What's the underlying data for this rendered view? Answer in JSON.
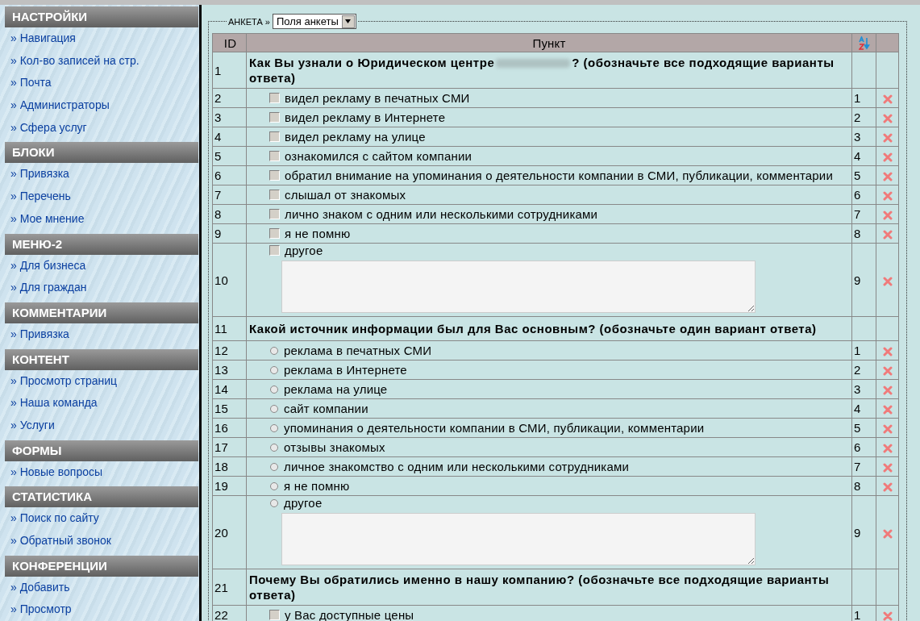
{
  "sidebar": [
    {
      "title": "НАСТРОЙКИ",
      "items": [
        "Навигация",
        "Кол-во записей на стр.",
        "Почта",
        "Администраторы",
        "Сфера услуг"
      ]
    },
    {
      "title": "БЛОКИ",
      "items": [
        "Привязка",
        "Перечень",
        "Мое мнение"
      ]
    },
    {
      "title": "МЕНЮ-2",
      "items": [
        "Для бизнеса",
        "Для граждан"
      ]
    },
    {
      "title": "КОММЕНТАРИИ",
      "items": [
        "Привязка"
      ]
    },
    {
      "title": "КОНТЕНТ",
      "items": [
        "Просмотр страниц",
        "Наша команда",
        "Услуги"
      ]
    },
    {
      "title": "ФОРМЫ",
      "items": [
        "Новые вопросы"
      ]
    },
    {
      "title": "СТАТИСТИКА",
      "items": [
        "Поиск по сайту",
        "Обратный звонок"
      ]
    },
    {
      "title": "КОНФЕРЕНЦИИ",
      "items": [
        "Добавить",
        "Просмотр"
      ]
    }
  ],
  "bullet": "»",
  "breadcrumb": "АНКЕТА »",
  "select": {
    "value": "Поля анкеты"
  },
  "table": {
    "columns": [
      "ID",
      "Пункт"
    ],
    "rows": [
      {
        "id": "1",
        "kind": "question",
        "text": "Как Вы узнали о Юридическом центре",
        "text_after": "? (обозначьте все подходящие варианты ответа)",
        "redacted": true
      },
      {
        "id": "2",
        "kind": "checkbox",
        "text": "видел рекламу в печатных СМИ",
        "order": "1",
        "checked": false
      },
      {
        "id": "3",
        "kind": "checkbox",
        "text": "видел рекламу в Интернете",
        "order": "2",
        "checked": false
      },
      {
        "id": "4",
        "kind": "checkbox",
        "text": "видел рекламу на улице",
        "order": "3",
        "checked": false
      },
      {
        "id": "5",
        "kind": "checkbox",
        "text": "ознакомился с сайтом компании",
        "order": "4",
        "checked": false
      },
      {
        "id": "6",
        "kind": "checkbox",
        "text": "обратил внимание на упоминания о деятельности компании в СМИ, публикации, комментарии",
        "order": "5",
        "checked": false
      },
      {
        "id": "7",
        "kind": "checkbox",
        "text": "слышал от знакомых",
        "order": "6",
        "checked": false
      },
      {
        "id": "8",
        "kind": "checkbox",
        "text": "лично знаком с одним или несколькими сотрудниками",
        "order": "7",
        "checked": false
      },
      {
        "id": "9",
        "kind": "checkbox",
        "text": "я не помню",
        "order": "8",
        "checked": false
      },
      {
        "id": "10",
        "kind": "checkbox",
        "text": "другое",
        "order": "9",
        "checked": false,
        "textarea": true
      },
      {
        "id": "11",
        "kind": "question",
        "text": "Какой источник информации был для Вас основным? (обозначьте один вариант ответа)",
        "redacted": false
      },
      {
        "id": "12",
        "kind": "radio",
        "text": "реклама в печатных СМИ",
        "order": "1",
        "selected": false
      },
      {
        "id": "13",
        "kind": "radio",
        "text": "реклама в Интернете",
        "order": "2",
        "selected": false
      },
      {
        "id": "14",
        "kind": "radio",
        "text": "реклама на улице",
        "order": "3",
        "selected": false
      },
      {
        "id": "15",
        "kind": "radio",
        "text": "сайт компании",
        "order": "4",
        "selected": false
      },
      {
        "id": "16",
        "kind": "radio",
        "text": "упоминания о деятельности компании в СМИ, публикации, комментарии",
        "order": "5",
        "selected": false
      },
      {
        "id": "17",
        "kind": "radio",
        "text": "отзывы знакомых",
        "order": "6",
        "selected": false
      },
      {
        "id": "18",
        "kind": "radio",
        "text": "личное знакомство с одним или несколькими сотрудниками",
        "order": "7",
        "selected": false
      },
      {
        "id": "19",
        "kind": "radio",
        "text": "я не помню",
        "order": "8",
        "selected": false
      },
      {
        "id": "20",
        "kind": "radio",
        "text": "другое",
        "order": "9",
        "selected": false,
        "textarea": true
      },
      {
        "id": "21",
        "kind": "question",
        "text": "Почему Вы обратились именно в нашу компанию? (обозначьте все подходящие варианты ответа)",
        "redacted": false
      },
      {
        "id": "22",
        "kind": "checkbox",
        "text": "у Вас доступные цены",
        "order": "1",
        "checked": false
      }
    ]
  }
}
